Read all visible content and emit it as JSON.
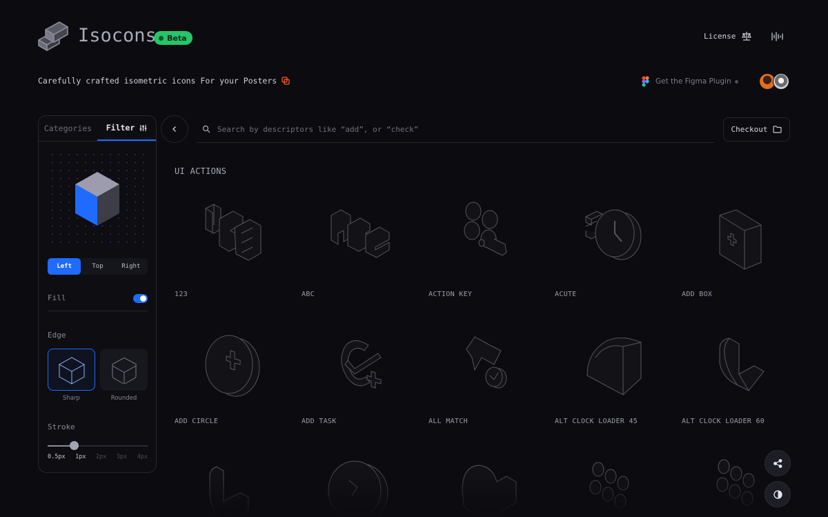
{
  "header": {
    "brand": "Isocons",
    "badge": "Beta",
    "license": "License",
    "tagline": "Carefully crafted isometric icons For your Posters",
    "figma": "Get the Figma Plugin"
  },
  "panel": {
    "tabs": [
      "Categories",
      "Filter"
    ],
    "active_tab": "Filter",
    "views": [
      "Left",
      "Top",
      "Right"
    ],
    "active_view": "Left",
    "fill_label": "Fill",
    "fill_on": true,
    "edge_label": "Edge",
    "edges": [
      "Sharp",
      "Rounded"
    ],
    "active_edge": "Sharp",
    "stroke_label": "Stroke",
    "strokes": [
      "0.5px",
      "1px",
      "2px",
      "3px",
      "4px"
    ],
    "active_stroke": "1px"
  },
  "search": {
    "placeholder": "Search by descriptors like “add”, or “check”"
  },
  "checkout": "Checkout",
  "section": "UI ACTIONS",
  "icons": [
    "123",
    "ABC",
    "ACTION KEY",
    "ACUTE",
    "ADD BOX",
    "ADD CIRCLE",
    "ADD TASK",
    "ALL MATCH",
    "ALT CLOCK LOADER 45",
    "ALT CLOCK LOADER 60"
  ],
  "colors": {
    "accent": "#1f6bff",
    "beta": "#27c46a",
    "background": "#0b0b10"
  }
}
